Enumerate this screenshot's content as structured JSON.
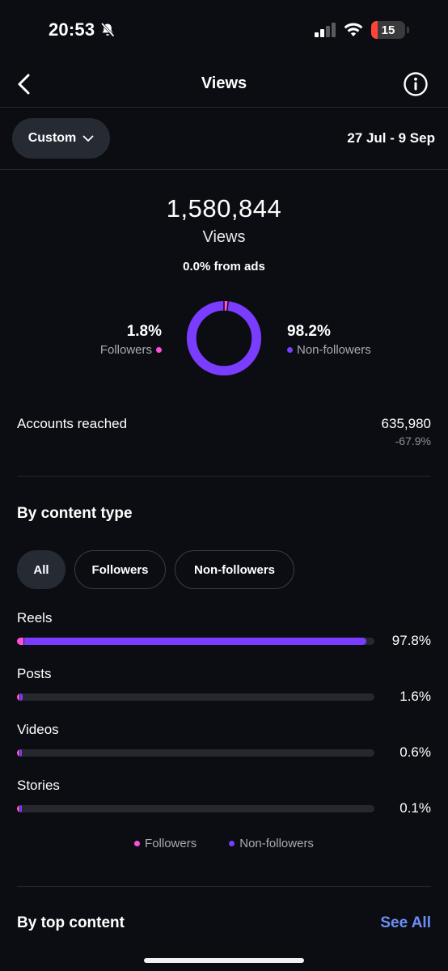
{
  "status_bar": {
    "time": "20:53",
    "battery_level": "15",
    "battery_color": "#ff453a"
  },
  "header": {
    "title": "Views",
    "back_icon": "chevron-left-icon",
    "info_icon": "info-icon"
  },
  "range": {
    "preset_label": "Custom",
    "date_range": "27 Jul - 9 Sep"
  },
  "summary": {
    "views_count": "1,580,844",
    "views_label": "Views",
    "ads_text": "0.0% from ads",
    "followers_pct": "1.8%",
    "followers_label": "Followers",
    "non_followers_pct": "98.2%",
    "non_followers_label": "Non-followers",
    "followers_share": 1.8,
    "non_followers_share": 98.2
  },
  "accounts_reached": {
    "label": "Accounts reached",
    "value": "635,980",
    "change": "-67.9%"
  },
  "by_content_type": {
    "title": "By content type",
    "filters": [
      {
        "label": "All",
        "active": true
      },
      {
        "label": "Followers",
        "active": false
      },
      {
        "label": "Non-followers",
        "active": false
      }
    ],
    "rows": [
      {
        "label": "Reels",
        "pct": "97.8%",
        "share": 97.8,
        "followers_share": 1.8
      },
      {
        "label": "Posts",
        "pct": "1.6%",
        "share": 1.6,
        "followers_share": 0.3
      },
      {
        "label": "Videos",
        "pct": "0.6%",
        "share": 0.6,
        "followers_share": 0.1
      },
      {
        "label": "Stories",
        "pct": "0.1%",
        "share": 0.1,
        "followers_share": 0.05
      }
    ],
    "legend": {
      "followers": "Followers",
      "non_followers": "Non-followers"
    }
  },
  "by_top_content": {
    "title": "By top content",
    "see_all": "See All"
  },
  "colors": {
    "followers": "#ff4fd8",
    "non_followers": "#7a3cff",
    "link": "#6d8ef7",
    "background": "#0b0d12"
  }
}
